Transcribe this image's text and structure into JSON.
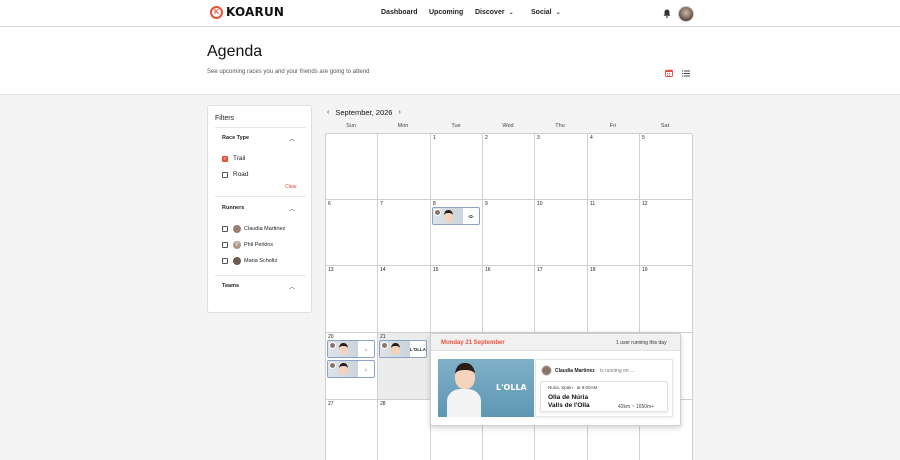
{
  "nav": {
    "logo_text": "KOARUN",
    "links": [
      {
        "label": "Dashboard"
      },
      {
        "label": "Upcoming"
      },
      {
        "label": "Discover"
      },
      {
        "label": "Social"
      }
    ]
  },
  "header": {
    "title": "Agenda",
    "subtitle": "See upcoming races you and your friends are going to attend"
  },
  "filters": {
    "title": "Filters",
    "race_type": {
      "title": "Race Type",
      "options": [
        {
          "label": "Trail",
          "checked": true
        },
        {
          "label": "Road",
          "checked": false
        }
      ],
      "clear_label": "Clear"
    },
    "runners": {
      "title": "Runners",
      "options": [
        {
          "label": "Claudia Martinez",
          "checked": false
        },
        {
          "label": "Phil Perkins",
          "checked": false
        },
        {
          "label": "Maria Scholtz",
          "checked": false
        }
      ]
    },
    "teams": {
      "title": "Teams"
    }
  },
  "calendar": {
    "month_label": "September, 2026",
    "weekdays": [
      "Sun",
      "Mon",
      "Tue",
      "Wed",
      "Thu",
      "Fri",
      "Sat"
    ],
    "weeks": [
      [
        "",
        "",
        "1",
        "2",
        "3",
        "4",
        "5"
      ],
      [
        "6",
        "7",
        "8",
        "9",
        "10",
        "11",
        "12"
      ],
      [
        "13",
        "14",
        "15",
        "16",
        "17",
        "18",
        "19"
      ],
      [
        "20",
        "21",
        "22",
        "23",
        "24",
        "25",
        "26"
      ],
      [
        "27",
        "28",
        "",
        "",
        "",
        "",
        ""
      ]
    ]
  },
  "popover": {
    "date_label": "Monday 21 September",
    "count_label": "1 user running this day",
    "runner_name": "Claudia Martinez",
    "runner_suffix": "is running on ...",
    "race_location": "Nuria, Spain",
    "race_time": "at 9:00AM",
    "race_name_line1": "Olla de Núria",
    "race_name_line2": "Valls de l'Olla",
    "race_distance": "42km",
    "race_elevation": "1650m+",
    "hero_logo_text": "L'OLLA"
  },
  "colors": {
    "accent": "#e8523a",
    "event_border": "#8aa3c4"
  },
  "icons": {
    "logo": "koarun-logo-icon",
    "bell": "bell-icon",
    "calendar_view": "calendar-icon",
    "list_view": "list-icon"
  }
}
